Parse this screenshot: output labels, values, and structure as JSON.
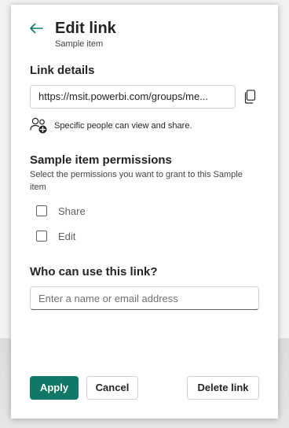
{
  "header": {
    "back_icon": "arrow-left-icon",
    "title": "Edit link",
    "subtitle": "Sample item"
  },
  "link_details": {
    "heading": "Link details",
    "url": "https://msit.powerbi.com/groups/me...",
    "copy_icon": "copy-icon",
    "people_icon": "people-add-icon",
    "audience_text": "Specific people can view and share."
  },
  "permissions": {
    "heading": "Sample item permissions",
    "description": "Select the permissions you want to grant to this Sample item",
    "options": [
      {
        "label": "Share",
        "checked": false
      },
      {
        "label": "Edit",
        "checked": false
      }
    ]
  },
  "who": {
    "heading": "Who can use this link?",
    "placeholder": "Enter a name or email address",
    "value": ""
  },
  "footer": {
    "apply_label": "Apply",
    "cancel_label": "Cancel",
    "delete_label": "Delete link"
  },
  "colors": {
    "accent": "#117865",
    "text": "#242424",
    "border": "#d1d1d1"
  }
}
